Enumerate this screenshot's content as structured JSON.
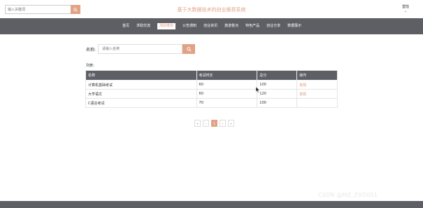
{
  "header": {
    "search_placeholder": "输入关键词",
    "site_title": "基于大数据技术的创业推荐系统",
    "login_label": "登陆"
  },
  "nav": {
    "items": [
      {
        "label": "首页"
      },
      {
        "label": "求助交流"
      },
      {
        "label": "测验模块"
      },
      {
        "label": "公告通知"
      },
      {
        "label": "创业资讯"
      },
      {
        "label": "旅游景点"
      },
      {
        "label": "特色产品"
      },
      {
        "label": "创业分享"
      },
      {
        "label": "数据展示"
      }
    ],
    "active_index": 2
  },
  "filter": {
    "label": "名称:",
    "placeholder": "请输入名称"
  },
  "list": {
    "label": "列表:",
    "columns": [
      "名称",
      "考试时长",
      "总分",
      "操作"
    ],
    "rows": [
      {
        "name": "计算机基础考试",
        "duration": "60",
        "score": "100",
        "action": "答题"
      },
      {
        "name": "大学语文",
        "duration": "60",
        "score": "120",
        "action": "答题"
      },
      {
        "name": "C语言考试",
        "duration": "70",
        "score": "100",
        "action": ""
      }
    ]
  },
  "pagination": {
    "first": "«",
    "prev": "‹",
    "current": "1",
    "next": "›",
    "last": "»"
  },
  "watermark": "CSDN @MZ_ZXD001",
  "colors": {
    "accent": "#e0a386",
    "nav_bg": "#5d5f65"
  }
}
